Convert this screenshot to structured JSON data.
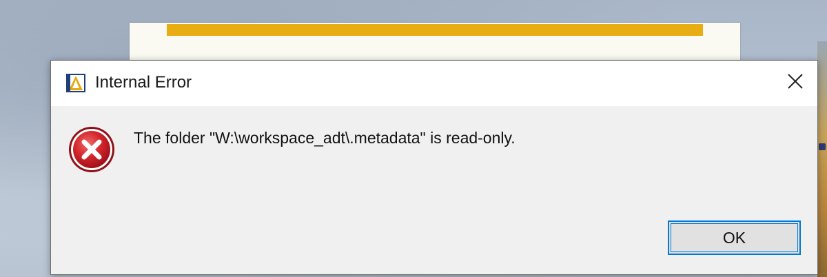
{
  "dialog": {
    "title": "Internal Error",
    "message": "The folder \"W:\\workspace_adt\\.metadata\" is read-only.",
    "ok_label": "OK",
    "icon": "error-icon",
    "app_icon": "eclipse-adt-icon",
    "close_icon": "close-icon"
  },
  "colors": {
    "splash_bar": "#e8ad12",
    "focus_border": "#0078d7",
    "error_red": "#c8161d"
  }
}
